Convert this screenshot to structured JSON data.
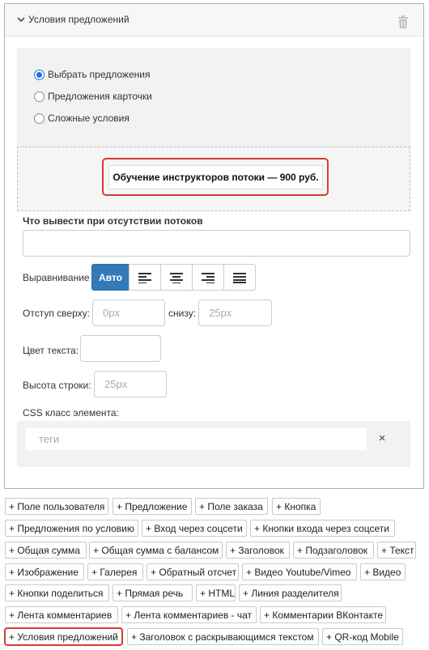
{
  "panel": {
    "title": "Условия предложений",
    "radio_options": [
      "Выбрать предложения",
      "Предложения карточки",
      "Сложные условия"
    ],
    "selected_option": "Выбрать предложения",
    "chip_label": "Обучение инструкторов потоки — 900 руб.",
    "no_streams_label": "Что вывести при отсутствии потоков",
    "no_streams_value": "",
    "alignment_label": "Выравнивание",
    "alignment_auto": "Авто",
    "margin_top_label": "Отступ сверху:",
    "margin_top_placeholder": "0px",
    "margin_bottom_label": "снизу:",
    "margin_bottom_placeholder": "25px",
    "text_color_label": "Цвет текста:",
    "line_height_label": "Высота строки:",
    "line_height_placeholder": "25px",
    "css_class_label": "CSS класс элемента:",
    "tags_placeholder": "теги",
    "tags_clear": "×"
  },
  "palette": [
    "+ Поле пользователя",
    "+ Предложение",
    "+ Поле заказа",
    "+ Кнопка",
    "+ Предложения по условию",
    "+ Вход через соцсети",
    "+ Кнопки входа через соцсети",
    "+ Общая сумма",
    "+ Общая сумма с балансом",
    "+ Заголовок",
    "+ Подзаголовок",
    "+ Текст",
    "+ Изображение",
    "+ Галерея",
    "+ Обратный отсчет",
    "+ Видео Youtube/Vimeo",
    "+ Видео",
    "+ Кнопки поделиться",
    "+ Прямая речь",
    "+ HTML",
    "+ Линия разделителя",
    "+ Лента комментариев",
    "+ Лента комментариев - чат",
    "+ Комментарии ВКонтакте",
    "+ Условия предложений",
    "+ Заголовок с раскрывающимся текстом",
    "+ QR-код Mobile"
  ]
}
